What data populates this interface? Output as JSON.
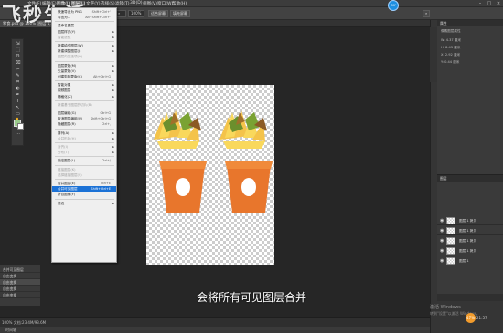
{
  "menubar": {
    "items": [
      "文件(F)",
      "编辑(E)",
      "图像(I)",
      "图层(L)",
      "文字(Y)",
      "选择(S)",
      "滤镜(T)",
      "3D(D)",
      "视图(V)",
      "窗口(W)",
      "帮助(H)"
    ]
  },
  "options": {
    "zoom": "100%",
    "button_fit": "适合屏幕",
    "button_fill": "填充屏幕",
    "checkbox_label": "细微缩放"
  },
  "watermark": "飞秒生活",
  "doc_tab": "零食.psd @ 100% (图层 1, RGB/8) *",
  "menu": {
    "items": [
      {
        "label": "快速导出为 PNG",
        "shortcut": "Shift+Ctrl+'",
        "disabled": false,
        "arrow": false
      },
      {
        "label": "导出为...",
        "shortcut": "Alt+Shift+Ctrl+'",
        "disabled": false,
        "arrow": false
      },
      {
        "label": "sep"
      },
      {
        "label": "重命名图层...",
        "shortcut": "",
        "disabled": false,
        "arrow": false
      },
      {
        "label": "图层样式(Y)",
        "shortcut": "",
        "disabled": false,
        "arrow": true
      },
      {
        "label": "智能滤镜",
        "shortcut": "",
        "disabled": true,
        "arrow": true
      },
      {
        "label": "sep"
      },
      {
        "label": "新建填充图层(W)",
        "shortcut": "",
        "disabled": false,
        "arrow": true
      },
      {
        "label": "新建调整图层(J)",
        "shortcut": "",
        "disabled": false,
        "arrow": true
      },
      {
        "label": "图层内容选项(O)...",
        "shortcut": "",
        "disabled": true,
        "arrow": false
      },
      {
        "label": "sep"
      },
      {
        "label": "图层蒙版(M)",
        "shortcut": "",
        "disabled": false,
        "arrow": true
      },
      {
        "label": "矢量蒙版(V)",
        "shortcut": "",
        "disabled": false,
        "arrow": true
      },
      {
        "label": "创建剪贴蒙版(C)",
        "shortcut": "Alt+Ctrl+G",
        "disabled": false,
        "arrow": false
      },
      {
        "label": "sep"
      },
      {
        "label": "智能对象",
        "shortcut": "",
        "disabled": false,
        "arrow": true
      },
      {
        "label": "视频图层",
        "shortcut": "",
        "disabled": false,
        "arrow": true
      },
      {
        "label": "栅格化(Z)",
        "shortcut": "",
        "disabled": false,
        "arrow": true
      },
      {
        "label": "sep"
      },
      {
        "label": "新建基于图层的切片(B)",
        "shortcut": "",
        "disabled": true,
        "arrow": false
      },
      {
        "label": "sep"
      },
      {
        "label": "图层编组(G)",
        "shortcut": "Ctrl+G",
        "disabled": false,
        "arrow": false
      },
      {
        "label": "取消图层编组(U)",
        "shortcut": "Shift+Ctrl+G",
        "disabled": false,
        "arrow": false
      },
      {
        "label": "隐藏图层(R)",
        "shortcut": "Ctrl+,",
        "disabled": false,
        "arrow": false
      },
      {
        "label": "sep"
      },
      {
        "label": "排列(A)",
        "shortcut": "",
        "disabled": false,
        "arrow": true
      },
      {
        "label": "合并形状(H)",
        "shortcut": "",
        "disabled": true,
        "arrow": true
      },
      {
        "label": "sep"
      },
      {
        "label": "对齐(I)",
        "shortcut": "",
        "disabled": true,
        "arrow": true
      },
      {
        "label": "分布(T)",
        "shortcut": "",
        "disabled": true,
        "arrow": true
      },
      {
        "label": "sep"
      },
      {
        "label": "锁定图层(L)...",
        "shortcut": "Ctrl+/",
        "disabled": false,
        "arrow": false
      },
      {
        "label": "sep"
      },
      {
        "label": "链接图层(K)",
        "shortcut": "",
        "disabled": true,
        "arrow": false
      },
      {
        "label": "选择链接图层(S)",
        "shortcut": "",
        "disabled": true,
        "arrow": false
      },
      {
        "label": "sep"
      },
      {
        "label": "合并图层(E)",
        "shortcut": "Ctrl+E",
        "disabled": false,
        "arrow": false
      },
      {
        "label": "合并可见图层",
        "shortcut": "Shift+Ctrl+E",
        "disabled": false,
        "arrow": false,
        "highlight": true
      },
      {
        "label": "拼合图像(F)",
        "shortcut": "",
        "disabled": false,
        "arrow": false
      },
      {
        "label": "sep"
      },
      {
        "label": "修边",
        "shortcut": "",
        "disabled": false,
        "arrow": true
      }
    ]
  },
  "tools": [
    "⇲",
    "⬚",
    "ʘ",
    "⌧",
    "✂",
    "✎",
    "⌗",
    "◐",
    "✒",
    "T",
    "↖",
    "▭",
    "✋",
    "⌕",
    "…"
  ],
  "history": [
    "合并可见图层",
    "自由变换",
    "自由变换",
    "自由变换",
    "自由变换"
  ],
  "subtitle": "会将所有可见图层合并",
  "status": "100%   文档:23.4M/93.6M",
  "timeline": "时间轴",
  "props": {
    "title": "属性",
    "type": "像素图层属性",
    "w": "W: 4.37 厘米",
    "h": "H: 8.43 厘米",
    "x": "X: 2.92 厘米",
    "y": "Y: 0.44 厘米"
  },
  "layers": {
    "rows": [
      "图层 1 拷贝",
      "图层 1 拷贝",
      "图层 1 拷贝",
      "图层 1 拷贝",
      "图层 1"
    ]
  },
  "windows_wm": {
    "line1": "激活 Windows",
    "line2": "转到\"设置\"以激活 Windows。"
  },
  "tray_time": "21:57",
  "badge": "47%",
  "avatar": "DIY"
}
